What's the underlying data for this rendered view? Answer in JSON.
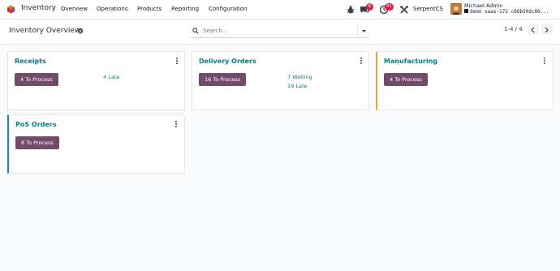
{
  "app": {
    "name": "Inventory",
    "menu": [
      "Overview",
      "Operations",
      "Products",
      "Reporting",
      "Configuration"
    ]
  },
  "systray": {
    "chat_badge": "6",
    "activity_badge": "41",
    "company": "SerpentCS",
    "user_name": "Michael Admin",
    "db_label": "demo saas-172 c66b50dc80..."
  },
  "control": {
    "title": "Inventory Overview",
    "search_placeholder": "Search...",
    "pager": "1-4 / 4"
  },
  "cards": [
    {
      "title": "Receipts",
      "button": "4 To Process",
      "stats": [
        "4 Late"
      ],
      "accent": "#ffffff"
    },
    {
      "title": "Delivery Orders",
      "button": "16 To Process",
      "stats": [
        "7 Waiting",
        "19 Late"
      ],
      "accent": "#ffffff"
    },
    {
      "title": "Manufacturing",
      "button": "4 To Process",
      "stats": [],
      "accent": "#e8a23a"
    },
    {
      "title": "PoS Orders",
      "button": "8 To Process",
      "stats": [],
      "accent": "#1a86c2"
    }
  ],
  "colors": {
    "primary": "#714b67",
    "link": "#017e84",
    "badge": "#e11d48"
  },
  "icons": [
    "app-logo-icon",
    "bug-icon",
    "chat-icon",
    "clock-icon",
    "tools-icon",
    "gear-icon",
    "search-icon",
    "caret-down-icon",
    "chevron-left-icon",
    "chevron-right-icon",
    "kebab-icon"
  ]
}
